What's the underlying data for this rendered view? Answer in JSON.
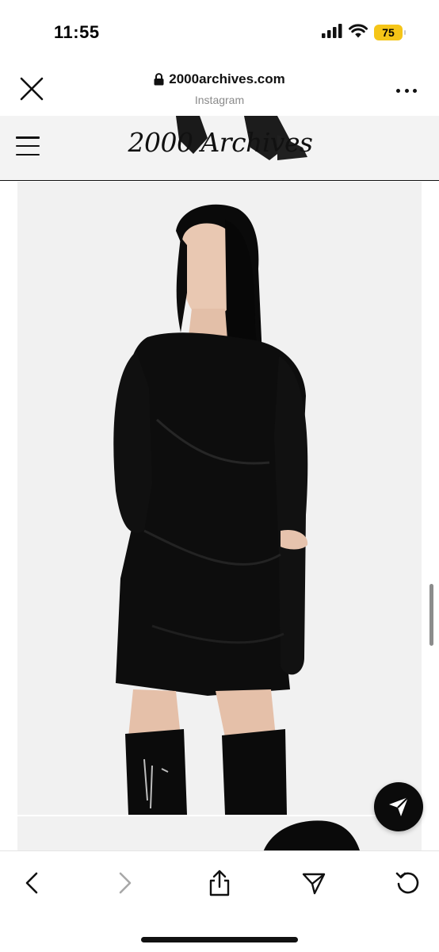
{
  "status_bar": {
    "time": "11:55",
    "battery_level": "75",
    "battery_color": "#f5c518",
    "icons": [
      "cellular-signal-icon",
      "wifi-icon",
      "battery-icon"
    ]
  },
  "browser": {
    "url": "2000archives.com",
    "source_app": "Instagram",
    "icons": [
      "close-icon",
      "lock-icon",
      "more-icon"
    ]
  },
  "site": {
    "logo_text": "2000 Archives",
    "icons": [
      "hamburger-menu-icon"
    ]
  },
  "product": {
    "image_alt": "model-black-mini-dress-photo",
    "colors": {
      "dress": "#0d0d0d",
      "background": "#f1f1f1"
    }
  },
  "floating": {
    "icons": [
      "send-icon"
    ]
  },
  "toolbar": {
    "icons": [
      "back-arrow-icon",
      "forward-arrow-icon",
      "share-icon",
      "send-icon",
      "reload-icon"
    ]
  }
}
